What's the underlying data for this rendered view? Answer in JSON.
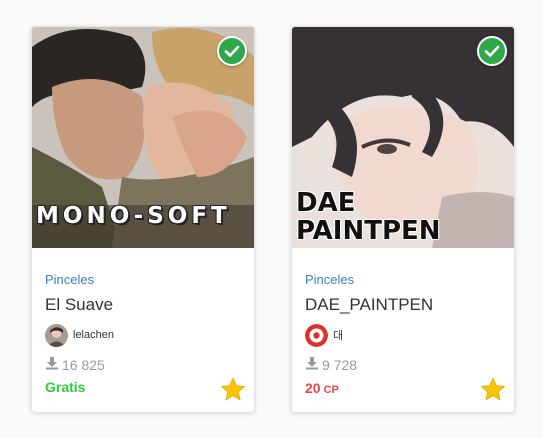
{
  "cards": [
    {
      "cover_text": "MONO-SOFT",
      "category": "Pinceles",
      "title": "El Suave",
      "author": "lelachen",
      "downloads": "16 825",
      "price": "Gratis",
      "verified_icon": "check-icon",
      "favorite_icon": "star-icon"
    },
    {
      "cover_text": "DAE\nPAINTPEN",
      "category": "Pinceles",
      "title": "DAE_PAINTPEN",
      "author": "대",
      "downloads": "9 728",
      "price": "20",
      "price_unit": "CP",
      "verified_icon": "check-icon",
      "favorite_icon": "star-icon"
    }
  ],
  "colors": {
    "category": "#3d7fc4",
    "free_price": "#2ecb3b",
    "paid_price": "#e24a4a",
    "badge": "#2ea84a",
    "star": "#f6c400"
  }
}
